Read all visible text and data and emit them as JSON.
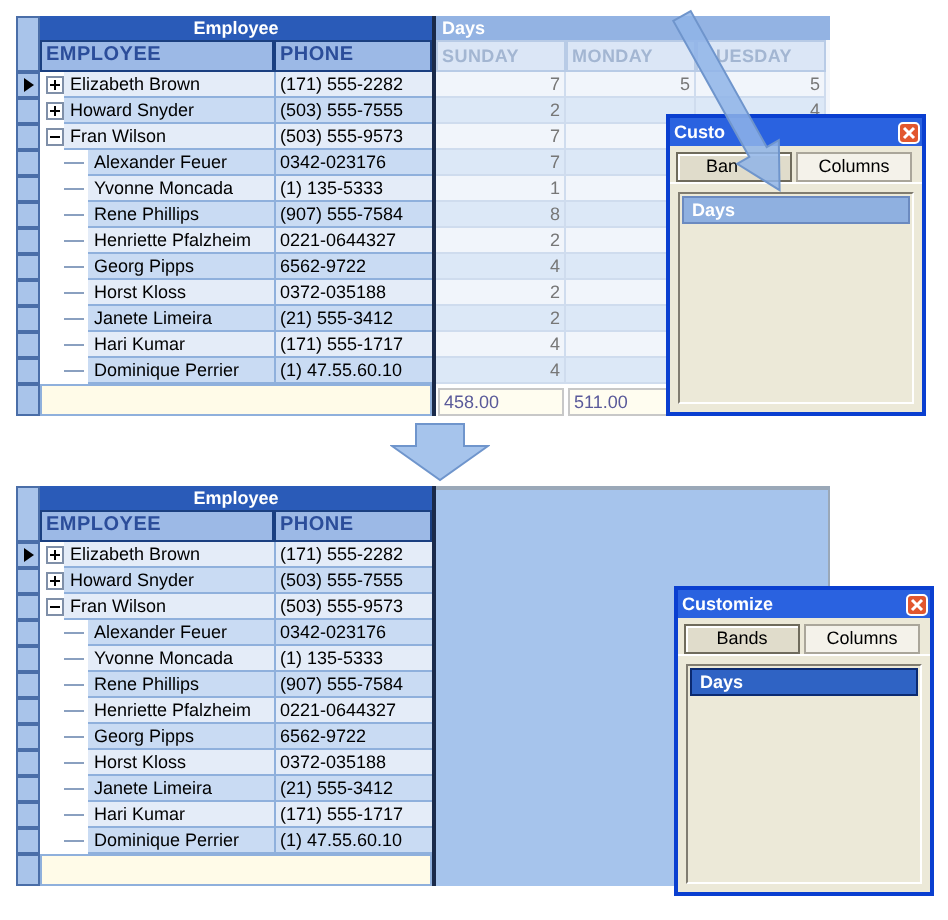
{
  "panels": [
    {
      "grid": {
        "band": "Employee",
        "columns": [
          "EMPLOYEE",
          "PHONE"
        ],
        "rows": [
          {
            "name": "Elizabeth Brown",
            "phone": "(171) 555-2282",
            "selected": true,
            "expanded": false
          },
          {
            "name": "Howard Snyder",
            "phone": "(503) 555-7555",
            "selected": false,
            "expanded": false
          },
          {
            "name": "Fran Wilson",
            "phone": "(503) 555-9573",
            "selected": false,
            "expanded": true,
            "children": [
              {
                "name": "Alexander Feuer",
                "phone": "0342-023176",
                "selected": false
              },
              {
                "name": "Yvonne Moncada",
                "phone": "(1) 135-5333",
                "selected": false
              },
              {
                "name": "Rene Phillips",
                "phone": "(907) 555-7584",
                "selected": false
              },
              {
                "name": "Henriette Pfalzheim",
                "phone": "0221-0644327",
                "selected": false
              },
              {
                "name": "Georg Pipps",
                "phone": "6562-9722",
                "selected": false
              },
              {
                "name": "Horst Kloss",
                "phone": "0372-035188",
                "selected": false
              },
              {
                "name": "Janete Limeira",
                "phone": "(21) 555-3412",
                "selected": false
              },
              {
                "name": "Hari Kumar",
                "phone": "(171) 555-1717",
                "selected": false
              },
              {
                "name": "Dominique Perrier",
                "phone": "(1) 47.55.60.10",
                "selected": false
              }
            ]
          }
        ]
      },
      "days_band": {
        "title": "Days",
        "columns": [
          "SUNDAY",
          "MONDAY",
          "UESDAY"
        ],
        "rows": [
          [
            "7",
            "5",
            "5"
          ],
          [
            "2",
            null,
            "4"
          ],
          [
            "7"
          ],
          [
            "7"
          ],
          [
            "1"
          ],
          [
            "8"
          ],
          [
            "2"
          ],
          [
            "4"
          ],
          [
            "2"
          ],
          [
            "2"
          ],
          [
            "4"
          ],
          [
            "4"
          ]
        ],
        "totals": [
          "458.00",
          "511.00"
        ]
      },
      "dialog": {
        "title": "Custo",
        "tabs": [
          {
            "label": "Ban",
            "selected": true
          },
          {
            "label": "Columns",
            "selected": false
          }
        ],
        "items": [
          {
            "label": "Days",
            "selected": false
          }
        ]
      }
    },
    {
      "grid": {
        "band": "Employee",
        "columns": [
          "EMPLOYEE",
          "PHONE"
        ],
        "rows": [
          {
            "name": "Elizabeth Brown",
            "phone": "(171) 555-2282",
            "selected": true,
            "expanded": false
          },
          {
            "name": "Howard Snyder",
            "phone": "(503) 555-7555",
            "selected": false,
            "expanded": false
          },
          {
            "name": "Fran Wilson",
            "phone": "(503) 555-9573",
            "selected": false,
            "expanded": true,
            "children": [
              {
                "name": "Alexander Feuer",
                "phone": "0342-023176",
                "selected": false
              },
              {
                "name": "Yvonne Moncada",
                "phone": "(1) 135-5333",
                "selected": false
              },
              {
                "name": "Rene Phillips",
                "phone": "(907) 555-7584",
                "selected": false
              },
              {
                "name": "Henriette Pfalzheim",
                "phone": "0221-0644327",
                "selected": false
              },
              {
                "name": "Georg Pipps",
                "phone": "6562-9722",
                "selected": false
              },
              {
                "name": "Horst Kloss",
                "phone": "0372-035188",
                "selected": false
              },
              {
                "name": "Janete Limeira",
                "phone": "(21) 555-3412",
                "selected": false
              },
              {
                "name": "Hari Kumar",
                "phone": "(171) 555-1717",
                "selected": false
              },
              {
                "name": "Dominique Perrier",
                "phone": "(1) 47.55.60.10",
                "selected": false
              }
            ]
          }
        ]
      },
      "dialog": {
        "title": "Customize",
        "tabs": [
          {
            "label": "Bands",
            "selected": true
          },
          {
            "label": "Columns",
            "selected": false
          }
        ],
        "items": [
          {
            "label": "Days",
            "selected": true
          }
        ]
      }
    }
  ]
}
